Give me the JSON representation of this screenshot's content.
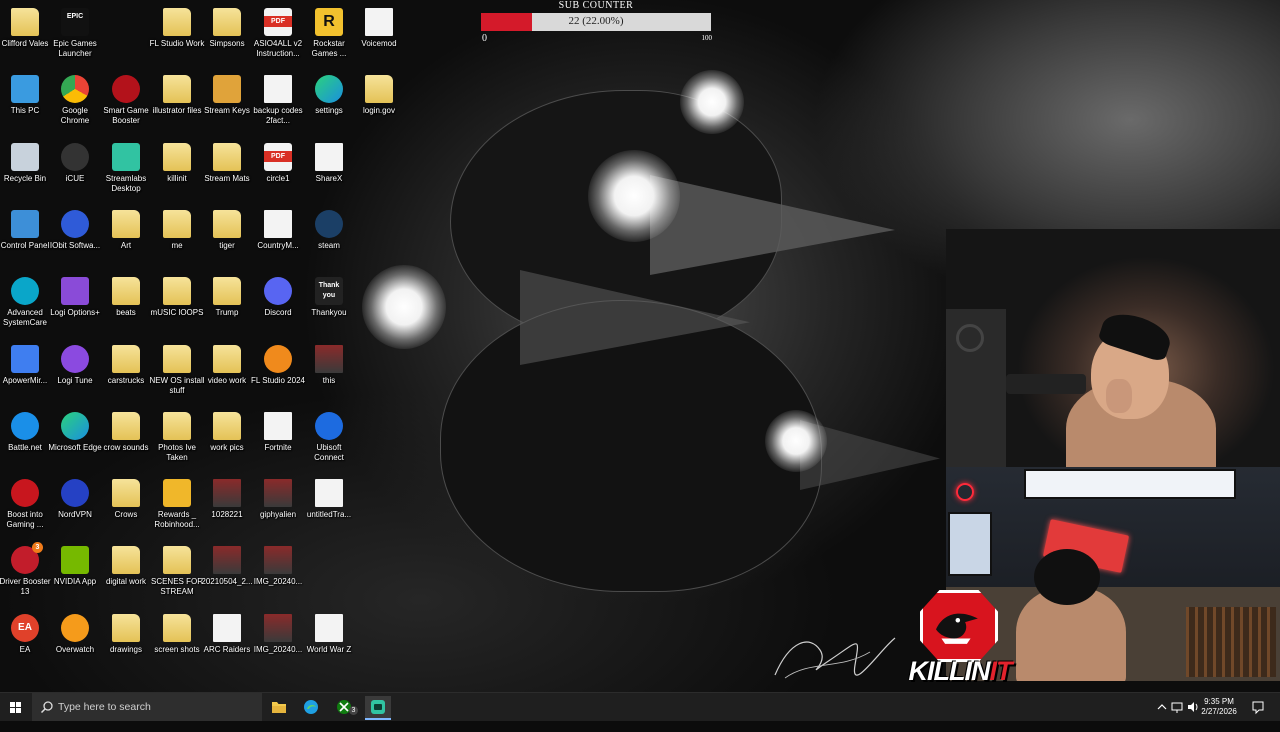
{
  "desktop": {
    "icons": [
      {
        "label": "Clifford Vales",
        "icon": "folder-person-icon"
      },
      {
        "label": "Epic Games Launcher",
        "icon": "epic-games-icon",
        "glyph": "EPIC"
      },
      {
        "label": "FL Studio Work",
        "icon": "folder-icon"
      },
      {
        "label": "Simpsons",
        "icon": "folder-icon"
      },
      {
        "label": "ASIO4ALL v2 Instruction...",
        "icon": "pdf-icon"
      },
      {
        "label": "Rockstar Games ...",
        "icon": "rockstar-icon",
        "glyph": "R"
      },
      {
        "label": "Voicemod",
        "icon": "document-icon"
      },
      {
        "label": "This PC",
        "icon": "computer-icon"
      },
      {
        "label": "Google Chrome",
        "icon": "chrome-icon"
      },
      {
        "label": "Smart Game Booster",
        "icon": "game-booster-icon"
      },
      {
        "label": "illustrator files",
        "icon": "folder-icon"
      },
      {
        "label": "Stream Keys",
        "icon": "key-icon"
      },
      {
        "label": "backup codes 2fact...",
        "icon": "document-icon"
      },
      {
        "label": "settings",
        "icon": "edge-icon"
      },
      {
        "label": "login.gov",
        "icon": "folder-icon"
      },
      {
        "label": "Recycle Bin",
        "icon": "recycle-bin-icon"
      },
      {
        "label": "iCUE",
        "icon": "icue-icon"
      },
      {
        "label": "Streamlabs Desktop",
        "icon": "streamlabs-icon"
      },
      {
        "label": "killinit",
        "icon": "folder-icon"
      },
      {
        "label": "Stream Mats",
        "icon": "folder-icon"
      },
      {
        "label": "circle1",
        "icon": "pdf-icon"
      },
      {
        "label": "ShareX",
        "icon": "document-icon"
      },
      {
        "label": "Control Panel",
        "icon": "control-panel-icon"
      },
      {
        "label": "IObit Softwa...",
        "icon": "iobit-icon"
      },
      {
        "label": "Art",
        "icon": "folder-icon"
      },
      {
        "label": "me",
        "icon": "folder-icon"
      },
      {
        "label": "tiger",
        "icon": "folder-icon"
      },
      {
        "label": "CountryM...",
        "icon": "document-icon"
      },
      {
        "label": "steam",
        "icon": "steam-icon"
      },
      {
        "label": "Advanced SystemCare",
        "icon": "systemcare-icon"
      },
      {
        "label": "Logi Options+",
        "icon": "logi-options-icon"
      },
      {
        "label": "beats",
        "icon": "folder-icon"
      },
      {
        "label": "mUSIC lOOPS",
        "icon": "folder-icon"
      },
      {
        "label": "Trump",
        "icon": "folder-icon"
      },
      {
        "label": "Discord",
        "icon": "discord-icon"
      },
      {
        "label": "Thankyou",
        "icon": "thankyou-image-icon",
        "glyph": "Thank you"
      },
      {
        "label": "ApowerMir...",
        "icon": "apowermirror-icon"
      },
      {
        "label": "Logi Tune",
        "icon": "logi-tune-icon"
      },
      {
        "label": "carstrucks",
        "icon": "folder-icon"
      },
      {
        "label": "NEW OS install stuff",
        "icon": "folder-icon"
      },
      {
        "label": "video work",
        "icon": "folder-icon"
      },
      {
        "label": "FL Studio 2024",
        "icon": "fl-studio-icon"
      },
      {
        "label": "this",
        "icon": "image-file-icon"
      },
      {
        "label": "Battle.net",
        "icon": "battlenet-icon"
      },
      {
        "label": "Microsoft Edge",
        "icon": "edge-icon"
      },
      {
        "label": "crow sounds",
        "icon": "folder-icon"
      },
      {
        "label": "Photos Ive Taken",
        "icon": "folder-icon"
      },
      {
        "label": "work pics",
        "icon": "folder-icon"
      },
      {
        "label": "Fortnite",
        "icon": "document-icon"
      },
      {
        "label": "Ubisoft Connect",
        "icon": "ubisoft-icon"
      },
      {
        "label": "Boost into Gaming ...",
        "icon": "boost-icon"
      },
      {
        "label": "NordVPN",
        "icon": "nordvpn-icon"
      },
      {
        "label": "Crows",
        "icon": "folder-icon"
      },
      {
        "label": "Rewards _ Robinhood...",
        "icon": "star-icon"
      },
      {
        "label": "1028221",
        "icon": "image-file-icon"
      },
      {
        "label": "giphyalien",
        "icon": "image-file-icon"
      },
      {
        "label": "untitledTra...",
        "icon": "video-file-icon"
      },
      {
        "label": "Driver Booster 13",
        "icon": "driver-booster-icon",
        "badge": "3"
      },
      {
        "label": "NVIDIA App",
        "icon": "nvidia-icon"
      },
      {
        "label": "digital work",
        "icon": "folder-icon"
      },
      {
        "label": "SCENES FOR STREAM",
        "icon": "folder-icon"
      },
      {
        "label": "20210504_2...",
        "icon": "image-file-icon"
      },
      {
        "label": "IMG_20240...",
        "icon": "image-file-icon"
      },
      {
        "label": "EA",
        "icon": "ea-icon",
        "glyph": "EA"
      },
      {
        "label": "Overwatch",
        "icon": "overwatch-icon"
      },
      {
        "label": "drawings",
        "icon": "folder-icon"
      },
      {
        "label": "screen shots",
        "icon": "folder-icon"
      },
      {
        "label": "ARC Raiders",
        "icon": "document-icon"
      },
      {
        "label": "IMG_20240...",
        "icon": "image-file-icon"
      },
      {
        "label": "World War Z",
        "icon": "document-icon"
      }
    ]
  },
  "sub_counter": {
    "title": "SUB COUNTER",
    "value_text": "22 (22.00%)",
    "progress": 0.22,
    "min": "0",
    "max": "100",
    "fill_color": "#d41a2a"
  },
  "overlay": {
    "logo_text_main": "KILLIN",
    "logo_text_accent": "IT",
    "accent_color": "#e3222c"
  },
  "taskbar": {
    "search_placeholder": "Type here to search",
    "xbox_badge": "3",
    "clock_time": "9:35 PM",
    "clock_date": "2/27/2026"
  }
}
